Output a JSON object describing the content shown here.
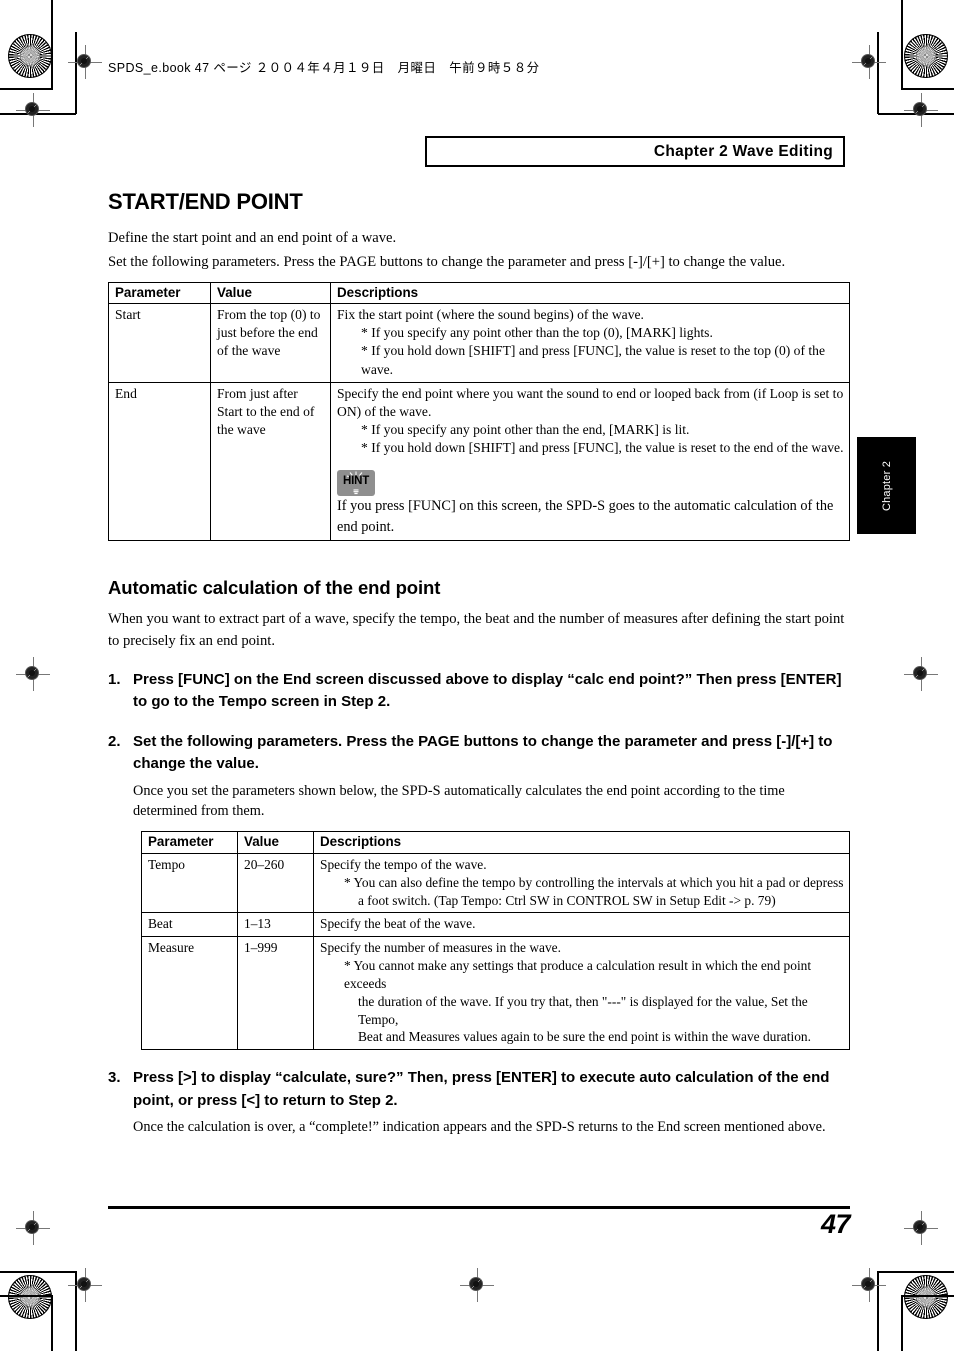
{
  "print_marks": {
    "book_stamp": "SPDS_e.book  47 ページ  ２００４年４月１９日　月曜日　午前９時５８分"
  },
  "header": {
    "chapter_label": "Chapter 2 Wave Editing"
  },
  "side_tab": {
    "label": "Chapter 2"
  },
  "main": {
    "title": "START/END POINT",
    "intro_line1": "Define the start point and an end point of a wave.",
    "intro_line2": "Set the following parameters. Press the PAGE buttons to change the parameter and press [-]/[+] to change the value.",
    "table1": {
      "headers": [
        "Parameter",
        "Value",
        "Descriptions"
      ],
      "rows": [
        {
          "parameter": "Start",
          "value": "From the top (0) to just before the end of the wave",
          "desc_lines": [
            "Fix the start point (where the sound begins) of the wave.",
            "* If you specify any point other than the top (0), [MARK] lights.",
            "* If you hold down [SHIFT] and press [FUNC], the value is reset to the top (0) of the wave."
          ]
        },
        {
          "parameter": "End",
          "value": "From just after Start to the end of the wave",
          "desc_lines": [
            "Specify the end point where you want the sound to end or looped back from (if Loop is set to",
            "ON) of the wave.",
            "* If you specify any point other than the end, [MARK] is lit.",
            "* If you hold down [SHIFT] and press [FUNC], the value is reset to the end of the wave."
          ],
          "hint": {
            "badge": "HINT",
            "text": "If you press [FUNC] on this screen, the SPD-S goes to the automatic calculation of the end point."
          }
        }
      ]
    },
    "section2": {
      "title": "Automatic calculation of the end point",
      "intro": "When you want to extract part of a wave, specify the tempo, the beat and the number of measures after defining the start point to precisely fix an end point.",
      "steps": [
        {
          "num": "1.",
          "head": "Press [FUNC] on the End screen discussed above to display “calc end point?” Then press [ENTER] to go to the Tempo screen in Step 2.",
          "note": ""
        },
        {
          "num": "2.",
          "head": "Set the following parameters. Press the PAGE buttons to change the parameter and press [-]/[+] to change the value.",
          "note": "Once you set the parameters shown below, the SPD-S automatically calculates the end point according to the time determined from them."
        },
        {
          "num": "3.",
          "head": "Press [>] to display “calculate, sure?” Then, press [ENTER] to execute auto calculation of the end point, or press [<] to return to Step 2.",
          "note": "Once the calculation is over, a “complete!” indication appears and the SPD-S returns to the End screen mentioned above."
        }
      ],
      "table2": {
        "headers": [
          "Parameter",
          "Value",
          "Descriptions"
        ],
        "rows": [
          {
            "parameter": "Tempo",
            "value": "20–260",
            "desc_lines": [
              "Specify the tempo of the wave.",
              "* You can also define the tempo by controlling the intervals at which you hit a pad or depress",
              "a foot switch. (Tap Tempo: Ctrl SW in CONTROL SW in Setup Edit -> p. 79)"
            ]
          },
          {
            "parameter": "Beat",
            "value": "1–13",
            "desc_lines": [
              "Specify the beat of the wave."
            ]
          },
          {
            "parameter": "Measure",
            "value": "1–999",
            "desc_lines": [
              "Specify the number of measures in the wave.",
              "* You cannot make any settings that produce a calculation result in which the end point exceeds",
              "the duration of the wave. If you try that, then \"---\" is displayed for the value, Set the Tempo,",
              "Beat and Measures values again to be sure the end point is within the wave duration."
            ]
          }
        ]
      }
    }
  },
  "footer": {
    "page_number": "47"
  }
}
